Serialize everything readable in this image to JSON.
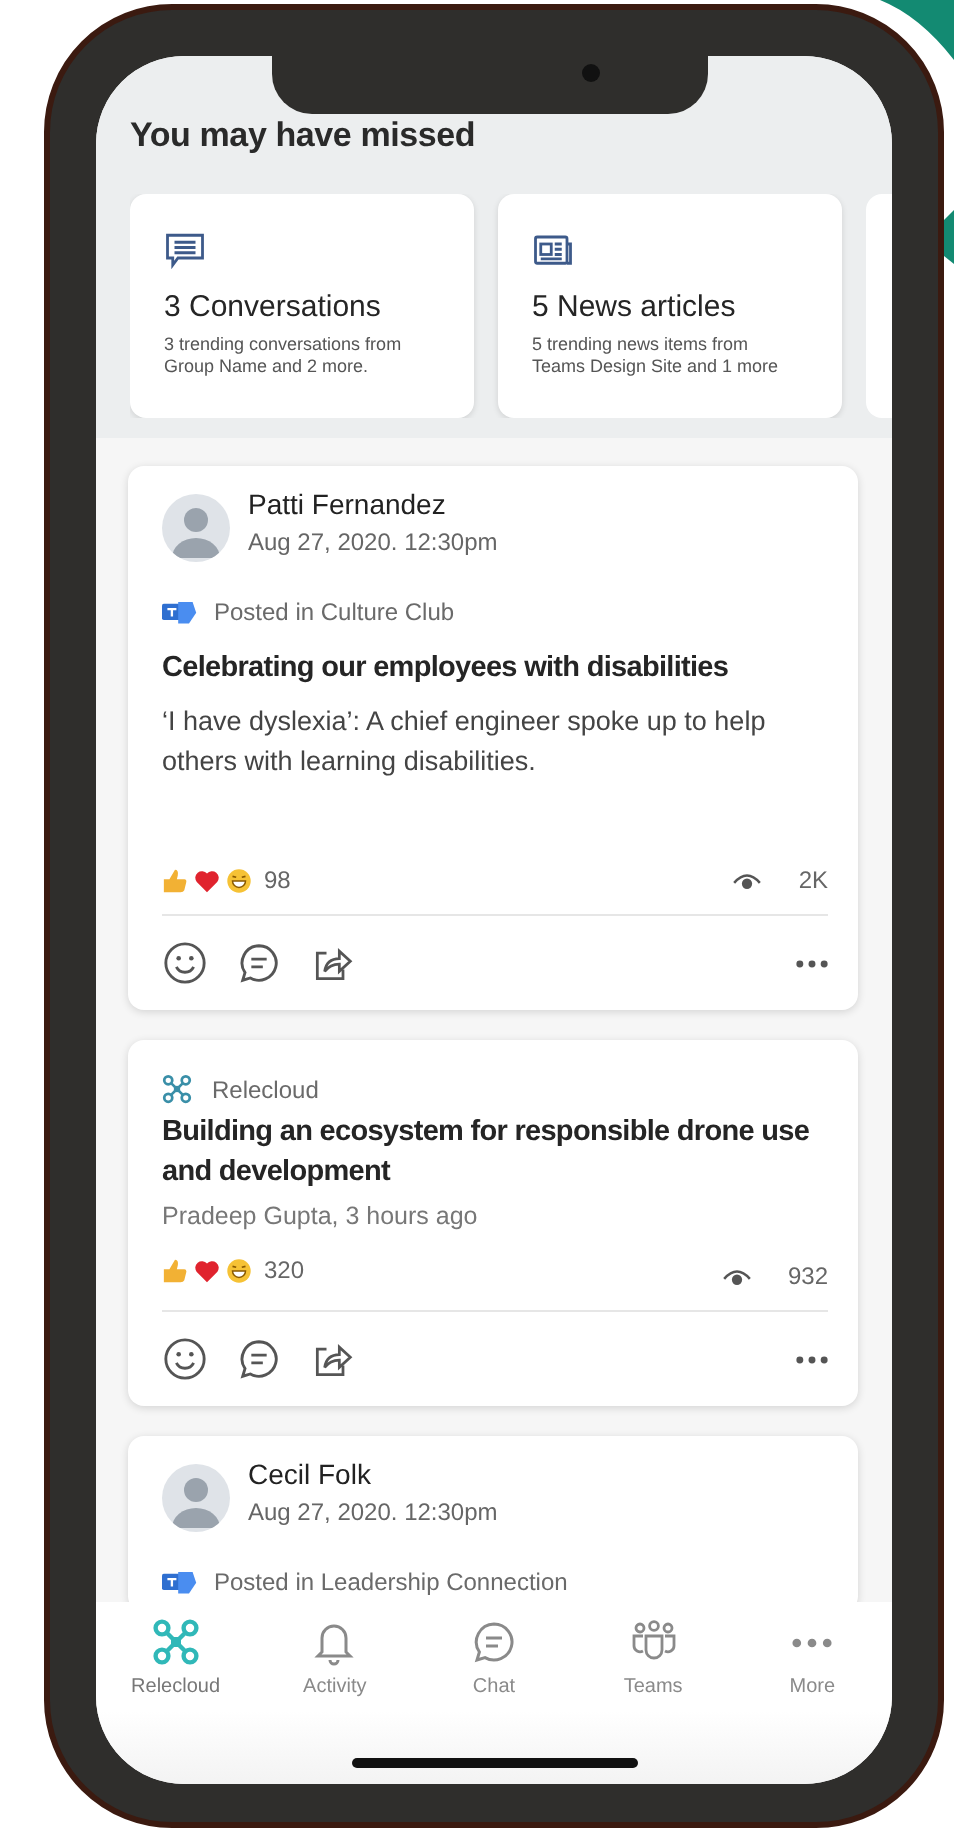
{
  "header": {
    "title": "You may have missed"
  },
  "highlights": [
    {
      "kind": "conversations",
      "title": "3 Conversations",
      "description": "3 trending conversations from Group Name and 2 more."
    },
    {
      "kind": "news",
      "title": "5 News articles",
      "description": "5 trending news items from Teams Design Site and 1 more"
    }
  ],
  "posts": [
    {
      "kind": "person",
      "author": "Patti Fernandez",
      "date": "Aug 27, 2020. 12:30pm",
      "posted_in": "Posted in Culture Club",
      "title": "Celebrating our employees with disabilities",
      "summary": "‘I have dyslexia’: A chief engineer spoke up to help others with learning disabilities.",
      "reactions": "98",
      "views": "2K"
    },
    {
      "kind": "community",
      "source": "Relecloud",
      "title": "Building an ecosystem for responsible drone use and development",
      "byline": "Pradeep Gupta, 3 hours ago",
      "reactions": "320",
      "views": "932"
    },
    {
      "kind": "person",
      "author": "Cecil Folk",
      "date": "Aug 27, 2020. 12:30pm",
      "posted_in": "Posted in Leadership Connection"
    }
  ],
  "tab_bar": [
    {
      "kind": "home",
      "label": "Relecloud",
      "selected": true
    },
    {
      "kind": "activity",
      "label": "Activity",
      "selected": false
    },
    {
      "kind": "chat",
      "label": "Chat",
      "selected": false
    },
    {
      "kind": "teams",
      "label": "Teams",
      "selected": false
    },
    {
      "kind": "more",
      "label": "More",
      "selected": false
    }
  ]
}
